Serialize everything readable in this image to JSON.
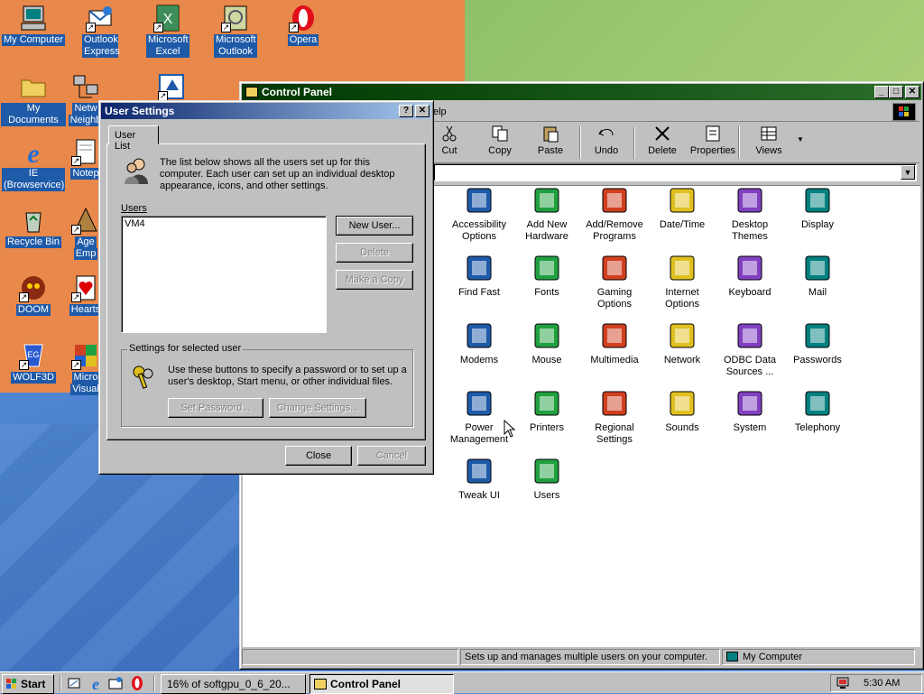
{
  "desktop": {
    "icons": [
      {
        "label": "My Computer",
        "icon": "my-computer-icon"
      },
      {
        "label": "Outlook Express",
        "icon": "outlook-express-icon"
      },
      {
        "label": "Microsoft Excel",
        "icon": "excel-icon"
      },
      {
        "label": "Microsoft Outlook",
        "icon": "outlook-icon"
      },
      {
        "label": "Opera",
        "icon": "opera-icon"
      },
      {
        "label": "My Documents",
        "icon": "folder-icon"
      },
      {
        "label": "Network Neighborhood",
        "icon": "network-icon"
      },
      {
        "label": "IE (Browservice)",
        "icon": "ie-icon"
      },
      {
        "label": "Notepad",
        "icon": "notepad-icon"
      },
      {
        "label": "Recycle Bin",
        "icon": "recycle-bin-icon"
      },
      {
        "label": "Age of Empires",
        "icon": "game-icon"
      },
      {
        "label": "DOOM",
        "icon": "doom-icon"
      },
      {
        "label": "Hearts",
        "icon": "hearts-icon"
      },
      {
        "label": "WOLF3D",
        "icon": "wolf3d-icon"
      },
      {
        "label": "Microsoft Visual",
        "icon": "visual-icon"
      }
    ],
    "partial_labels": {
      "net": "Netw",
      "neigh": "Neighb",
      "note": "Notep",
      "age": "Age",
      "emp": "Emp",
      "micro": "Micro",
      "visual": "Visual"
    }
  },
  "control_panel": {
    "title": "Control Panel",
    "menu_partial": "elp",
    "toolbar": [
      {
        "label": "Cut",
        "icon": "cut-icon"
      },
      {
        "label": "Copy",
        "icon": "copy-icon"
      },
      {
        "label": "Paste",
        "icon": "paste-icon"
      },
      {
        "label": "Undo",
        "icon": "undo-icon"
      },
      {
        "label": "Delete",
        "icon": "delete-icon"
      },
      {
        "label": "Properties",
        "icon": "properties-icon"
      },
      {
        "label": "Views",
        "icon": "views-icon"
      }
    ],
    "items": [
      [
        "Accessibility",
        "Options"
      ],
      [
        "Add New",
        "Hardware"
      ],
      [
        "Add/Remove",
        "Programs"
      ],
      [
        "Date/Time",
        ""
      ],
      [
        "Desktop",
        "Themes"
      ],
      [
        "Display",
        ""
      ],
      [
        "Find Fast",
        ""
      ],
      [
        "Fonts",
        ""
      ],
      [
        "Gaming",
        "Options"
      ],
      [
        "Internet",
        "Options"
      ],
      [
        "Keyboard",
        ""
      ],
      [
        "Mail",
        ""
      ],
      [
        "Modems",
        ""
      ],
      [
        "Mouse",
        ""
      ],
      [
        "Multimedia",
        ""
      ],
      [
        "Network",
        ""
      ],
      [
        "ODBC Data",
        "Sources ..."
      ],
      [
        "Passwords",
        ""
      ],
      [
        "Power",
        "Management"
      ],
      [
        "Printers",
        ""
      ],
      [
        "Regional",
        "Settings"
      ],
      [
        "Sounds",
        ""
      ],
      [
        "System",
        ""
      ],
      [
        "Telephony",
        ""
      ],
      [
        "Tweak UI",
        ""
      ],
      [
        "Users",
        ""
      ]
    ],
    "status_text": "Sets up and manages multiple users on your computer.",
    "status_zone": "My Computer"
  },
  "user_settings": {
    "title": "User Settings",
    "help_btn": "?",
    "close_btn": "✕",
    "tab": "User List",
    "intro": "The list below shows all the users set up for this computer. Each user can set up an individual desktop appearance, icons, and other settings.",
    "users_label": "Users",
    "users": [
      "VM4"
    ],
    "new_user": "New User...",
    "delete": "Delete",
    "make_copy": "Make a Copy",
    "group_title": "Settings for selected user",
    "group_text": "Use these buttons to specify a password or to set up a user's desktop, Start menu, or other individual files.",
    "set_password": "Set Password...",
    "change_settings": "Change Settings...",
    "close": "Close",
    "cancel": "Cancel"
  },
  "taskbar": {
    "start": "Start",
    "tasks": [
      "16% of softgpu_0_6_20...",
      "Control Panel"
    ],
    "clock": "5:30 AM"
  },
  "colors": {
    "title_active": "#0a246a",
    "title_inactive": "#003800",
    "selection": "#1e5aa8"
  }
}
